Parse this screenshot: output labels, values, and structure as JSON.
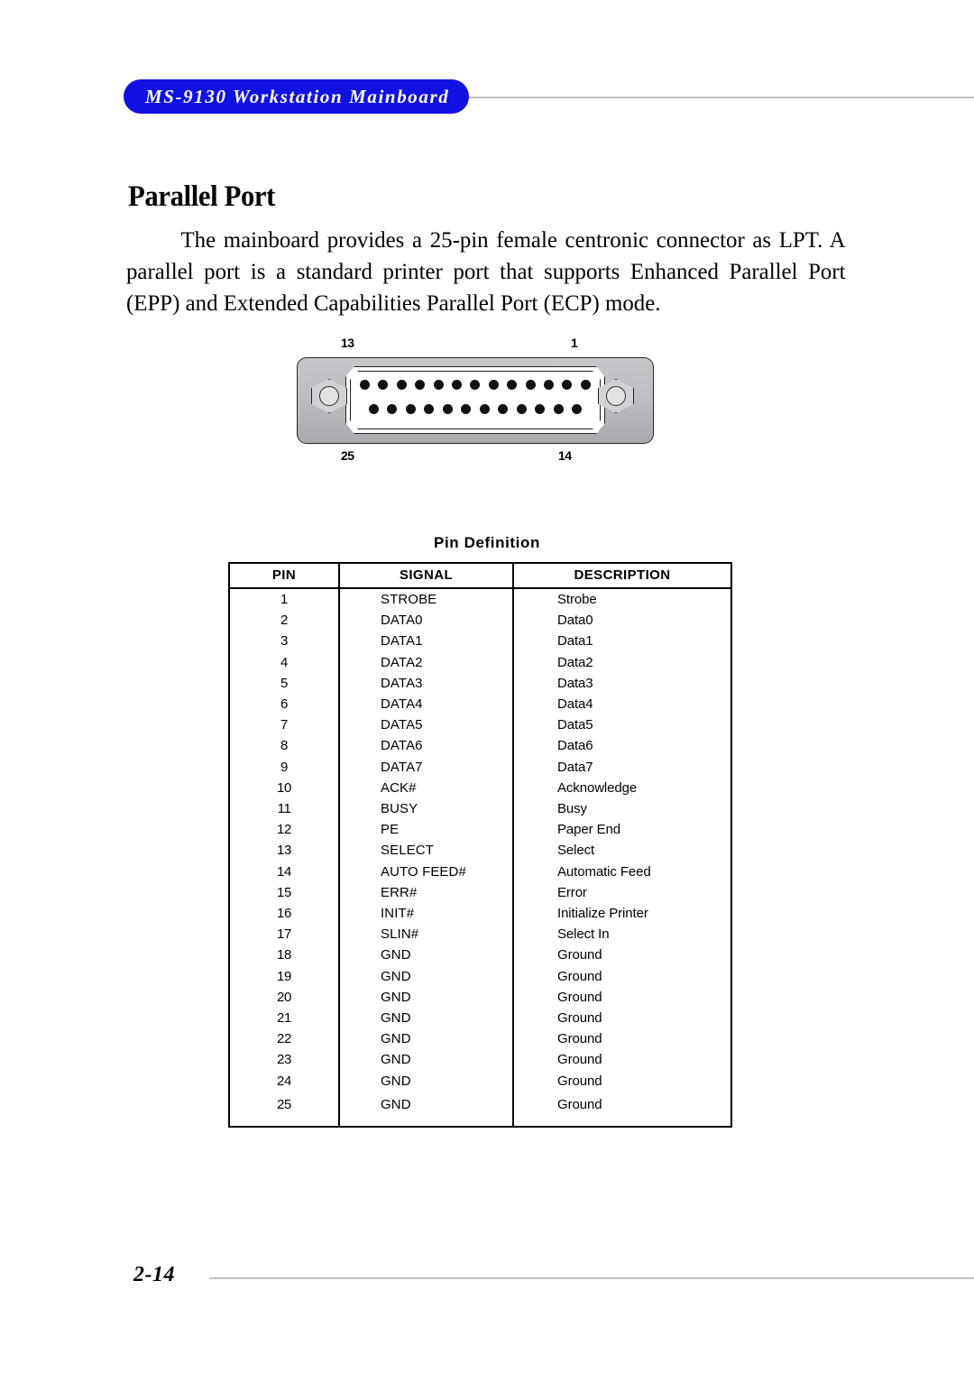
{
  "header": {
    "title": "MS-9130 Workstation Mainboard",
    "accent_color": "#1111e2",
    "rule_color": "#c4c4c4"
  },
  "section": {
    "title": "Parallel Port",
    "paragraph": "The mainboard provides a 25-pin female centronic connector as LPT. A parallel port is a standard printer port that supports Enhanced Parallel Port (EPP) and Extended Capabilities Parallel Port (ECP) mode."
  },
  "connector": {
    "labels": {
      "top_left": "13",
      "top_right": "1",
      "bottom_left": "25",
      "bottom_right": "14"
    },
    "top_row_pins": 13,
    "bottom_row_pins": 12,
    "shell_color": "#bdbdc2",
    "pin_color": "#111111"
  },
  "table": {
    "caption": "Pin Definition",
    "columns": [
      "PIN",
      "SIGNAL",
      "DESCRIPTION"
    ],
    "rows": [
      {
        "pin": "1",
        "signal": "STROBE",
        "description": "Strobe"
      },
      {
        "pin": "2",
        "signal": "DATA0",
        "description": "Data0"
      },
      {
        "pin": "3",
        "signal": "DATA1",
        "description": "Data1"
      },
      {
        "pin": "4",
        "signal": "DATA2",
        "description": "Data2"
      },
      {
        "pin": "5",
        "signal": "DATA3",
        "description": "Data3"
      },
      {
        "pin": "6",
        "signal": "DATA4",
        "description": "Data4"
      },
      {
        "pin": "7",
        "signal": "DATA5",
        "description": "Data5"
      },
      {
        "pin": "8",
        "signal": "DATA6",
        "description": "Data6"
      },
      {
        "pin": "9",
        "signal": "DATA7",
        "description": "Data7"
      },
      {
        "pin": "10",
        "signal": "ACK#",
        "description": "Acknowledge"
      },
      {
        "pin": "11",
        "signal": "BUSY",
        "description": "Busy"
      },
      {
        "pin": "12",
        "signal": "PE",
        "description": "Paper End"
      },
      {
        "pin": "13",
        "signal": "SELECT",
        "description": "Select"
      },
      {
        "pin": "14",
        "signal": "AUTO FEED#",
        "description": "Automatic Feed"
      },
      {
        "pin": "15",
        "signal": "ERR#",
        "description": "Error"
      },
      {
        "pin": "16",
        "signal": "INIT#",
        "description": "Initialize Printer"
      },
      {
        "pin": "17",
        "signal": "SLIN#",
        "description": "Select In"
      },
      {
        "pin": "18",
        "signal": "GND",
        "description": "Ground"
      },
      {
        "pin": "19",
        "signal": "GND",
        "description": "Ground"
      },
      {
        "pin": "20",
        "signal": "GND",
        "description": "Ground"
      },
      {
        "pin": "21",
        "signal": "GND",
        "description": "Ground"
      },
      {
        "pin": "22",
        "signal": "GND",
        "description": "Ground"
      },
      {
        "pin": "23",
        "signal": "GND",
        "description": "Ground"
      },
      {
        "pin": "24",
        "signal": "GND",
        "description": "Ground"
      },
      {
        "pin": "25",
        "signal": "GND",
        "description": "Ground"
      }
    ]
  },
  "footer": {
    "page_number": "2-14"
  }
}
